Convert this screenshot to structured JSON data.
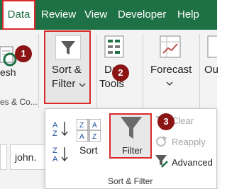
{
  "tabs": [
    {
      "label": "Data",
      "active": true
    },
    {
      "label": "Review"
    },
    {
      "label": "View"
    },
    {
      "label": "Developer"
    },
    {
      "label": "Help"
    }
  ],
  "ribbon": {
    "refresh_partial": "esh",
    "queries_partial": "es & Co...",
    "sort_filter_label_line1": "Sort &",
    "sort_filter_label_line2": "Filter",
    "data_tools_line1": "Data",
    "data_tools_line2": "Tools",
    "forecast_label": "Forecast",
    "outline_partial": "Ou"
  },
  "dropdown": {
    "sort_label": "Sort",
    "filter_label": "Filter",
    "clear_label": "Clear",
    "reapply_label": "Reapply",
    "advanced_label": "Advanced",
    "group_label": "Sort & Filter"
  },
  "sheet": {
    "cell_value": "john."
  },
  "badges": [
    "1",
    "2",
    "3"
  ],
  "colors": {
    "excel_green": "#1e7145",
    "highlight_red": "#d92b2b",
    "badge_red": "#8b1414"
  }
}
